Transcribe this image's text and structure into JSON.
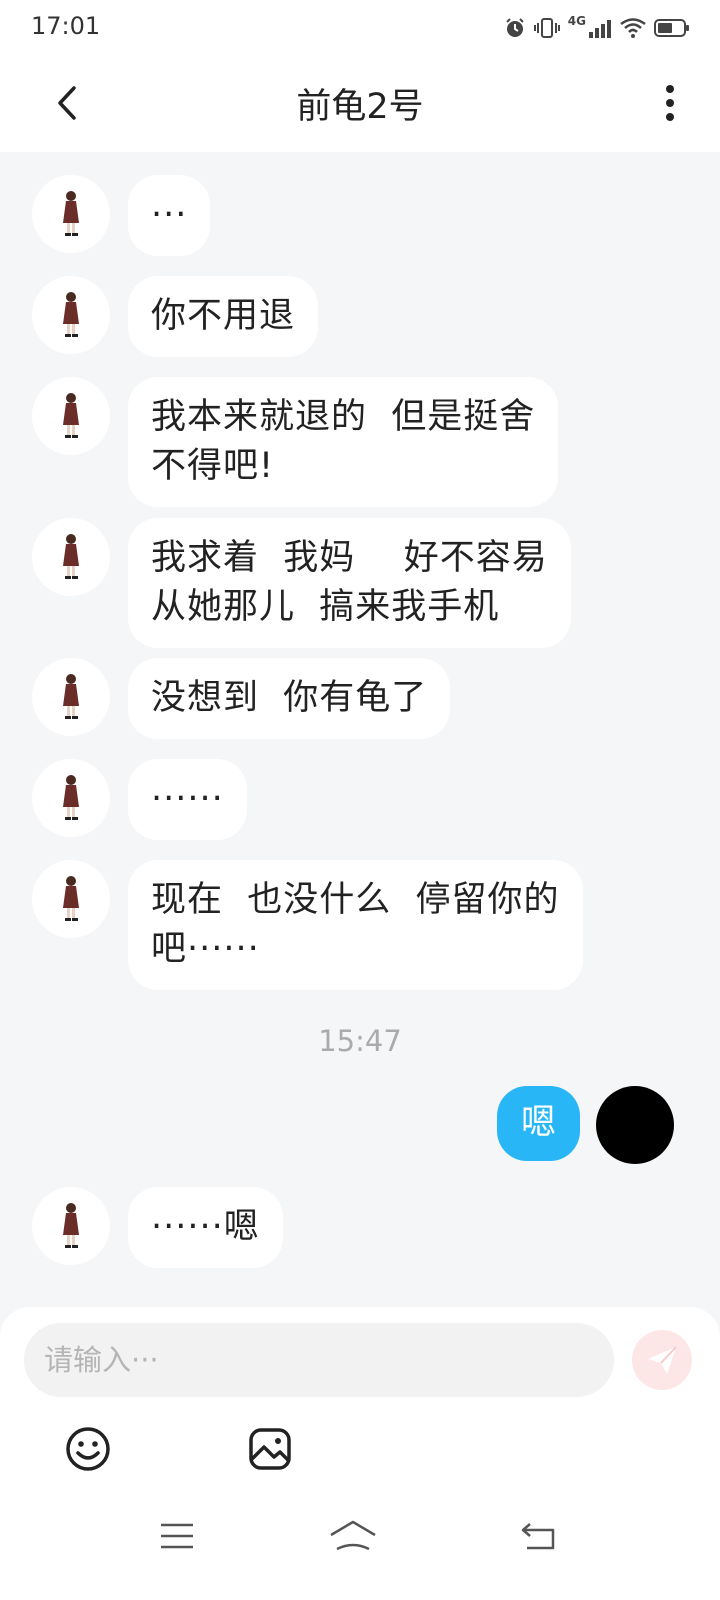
{
  "status_bar": {
    "time": "17:01",
    "network": "4G"
  },
  "header": {
    "title": "前龟2号"
  },
  "messages_incoming_before": [
    {
      "text": "···"
    },
    {
      "text": "你不用退"
    },
    {
      "text": "我本来就退的  但是挺舍\n不得吧!"
    },
    {
      "text": "我求着  我妈    好不容易\n从她那儿  搞来我手机"
    },
    {
      "text": "没想到  你有龟了"
    },
    {
      "text": "······"
    },
    {
      "text": "现在  也没什么  停留你的\n吧······"
    }
  ],
  "timestamp": "15:47",
  "outgoing": {
    "text": "嗯"
  },
  "incoming_after": {
    "text": "······嗯"
  },
  "composer": {
    "placeholder": "请输入···"
  },
  "colors": {
    "accent": "#29b6f6",
    "background": "#f5f6f8",
    "send_button": "#fde6e6"
  },
  "icons": {
    "back": "chevron-left-icon",
    "more": "more-vertical-icon",
    "emoji": "emoji-icon",
    "image": "image-icon",
    "send": "send-icon"
  }
}
